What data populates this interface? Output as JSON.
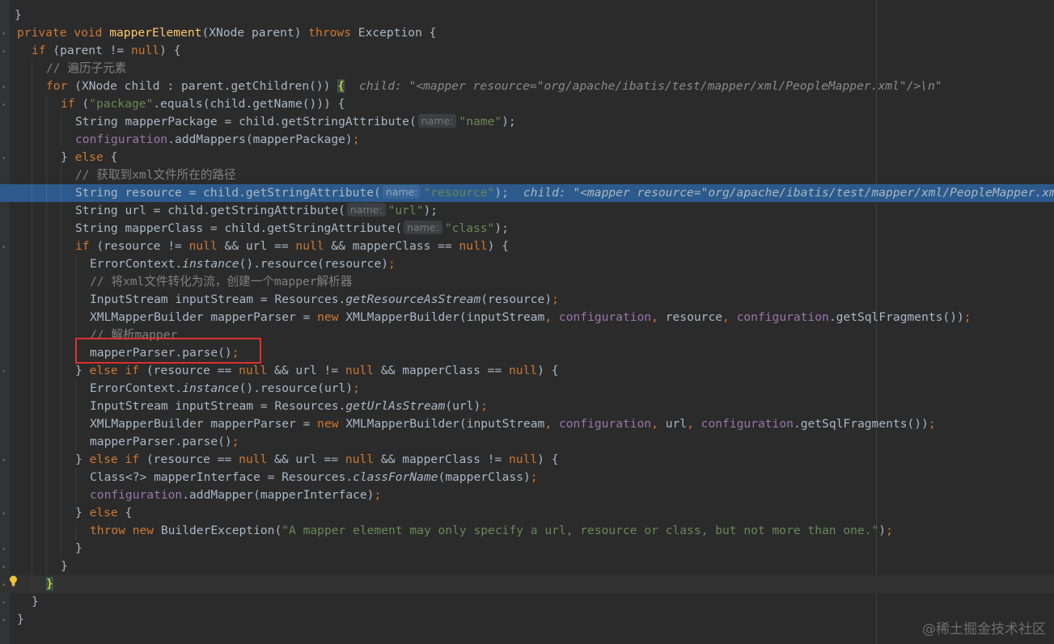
{
  "editor": {
    "lines": [
      {
        "id": "top",
        "tokens": [
          {
            "t": "}",
            "c": ""
          }
        ]
      },
      {
        "id": "method-decl",
        "tokens": [
          {
            "t": "private void ",
            "c": "kw"
          },
          {
            "t": "mapperElement",
            "c": "fn"
          },
          {
            "t": "(XNode parent) ",
            "c": ""
          },
          {
            "t": "throws ",
            "c": "kw"
          },
          {
            "t": "Exception {",
            "c": ""
          }
        ]
      },
      {
        "id": "if-parent",
        "tokens": [
          {
            "t": "if ",
            "c": "kw"
          },
          {
            "t": "(parent != ",
            "c": ""
          },
          {
            "t": "null",
            "c": "kw"
          },
          {
            "t": ") {",
            "c": ""
          }
        ]
      },
      {
        "id": "comment-iterate",
        "tokens": [
          {
            "t": "// 遍历子元素",
            "c": "cm"
          }
        ]
      },
      {
        "id": "for-loop",
        "tokens": [
          {
            "t": "for ",
            "c": "kw"
          },
          {
            "t": "(XNode child : parent.getChildren()) ",
            "c": ""
          },
          {
            "t": "{",
            "c": "brace-match"
          },
          {
            "t": "child: \"<mapper resource=\"org/apache/ibatis/test/mapper/xml/PeopleMapper.xml\"/>\\n\"",
            "c": "inline-val"
          }
        ]
      },
      {
        "id": "if-package",
        "tokens": [
          {
            "t": "if ",
            "c": "kw"
          },
          {
            "t": "(",
            "c": ""
          },
          {
            "t": "\"package\"",
            "c": "str"
          },
          {
            "t": ".equals(child.getName())) {",
            "c": ""
          }
        ]
      },
      {
        "id": "mapper-package",
        "tokens": [
          {
            "t": "String mapperPackage = child.getStringAttribute(",
            "c": ""
          },
          {
            "t": "name:",
            "c": "hint"
          },
          {
            "t": "\"name\"",
            "c": "str"
          },
          {
            "t": ");",
            "c": ""
          }
        ]
      },
      {
        "id": "add-mappers",
        "tokens": [
          {
            "t": "configuration",
            "c": "fld"
          },
          {
            "t": ".addMappers(mapperPackage)",
            "c": ""
          },
          {
            "t": ";",
            "c": "kw"
          }
        ]
      },
      {
        "id": "else-1",
        "tokens": [
          {
            "t": "} ",
            "c": ""
          },
          {
            "t": "else ",
            "c": "kw"
          },
          {
            "t": "{",
            "c": ""
          }
        ]
      },
      {
        "id": "comment-path",
        "tokens": [
          {
            "t": "// 获取到xml文件所在的路径",
            "c": "cm"
          }
        ]
      },
      {
        "id": "resource-line",
        "tokens": [
          {
            "t": "String resource = child.getStringAttribute(",
            "c": ""
          },
          {
            "t": "name:",
            "c": "hint"
          },
          {
            "t": "\"resource\"",
            "c": "str"
          },
          {
            "t": ");",
            "c": ""
          },
          {
            "t": "child: \"<mapper resource=\"org/apache/ibatis/test/mapper/xml/PeopleMapper.xml\"/>\\n\"",
            "c": "inline-val"
          }
        ]
      },
      {
        "id": "url-line",
        "tokens": [
          {
            "t": "String url = child.getStringAttribute(",
            "c": ""
          },
          {
            "t": "name:",
            "c": "hint"
          },
          {
            "t": "\"url\"",
            "c": "str"
          },
          {
            "t": ");",
            "c": ""
          }
        ]
      },
      {
        "id": "class-line",
        "tokens": [
          {
            "t": "String mapperClass = child.getStringAttribute(",
            "c": ""
          },
          {
            "t": "name:",
            "c": "hint"
          },
          {
            "t": "\"class\"",
            "c": "str"
          },
          {
            "t": ");",
            "c": ""
          }
        ]
      },
      {
        "id": "if-resource",
        "tokens": [
          {
            "t": "if ",
            "c": "kw"
          },
          {
            "t": "(resource != ",
            "c": ""
          },
          {
            "t": "null ",
            "c": "kw"
          },
          {
            "t": "&& url == ",
            "c": ""
          },
          {
            "t": "null ",
            "c": "kw"
          },
          {
            "t": "&& mapperClass == ",
            "c": ""
          },
          {
            "t": "null",
            "c": "kw"
          },
          {
            "t": ") {",
            "c": ""
          }
        ]
      },
      {
        "id": "error-context-1",
        "tokens": [
          {
            "t": "ErrorContext.",
            "c": ""
          },
          {
            "t": "instance",
            "c": "it"
          },
          {
            "t": "().resource(resource)",
            "c": ""
          },
          {
            "t": ";",
            "c": "kw"
          }
        ]
      },
      {
        "id": "comment-stream",
        "tokens": [
          {
            "t": "// 将xml文件转化为流，创建一个mapper解析器",
            "c": "cm"
          }
        ]
      },
      {
        "id": "input-stream-1",
        "tokens": [
          {
            "t": "InputStream inputStream = Resources.",
            "c": ""
          },
          {
            "t": "getResourceAsStream",
            "c": "it"
          },
          {
            "t": "(resource)",
            "c": ""
          },
          {
            "t": ";",
            "c": "kw"
          }
        ]
      },
      {
        "id": "builder-1",
        "tokens": [
          {
            "t": "XMLMapperBuilder mapperParser = ",
            "c": ""
          },
          {
            "t": "new ",
            "c": "kw"
          },
          {
            "t": "XMLMapperBuilder(inputStream",
            "c": ""
          },
          {
            "t": ", ",
            "c": "kw"
          },
          {
            "t": "configuration",
            "c": "fld"
          },
          {
            "t": ", ",
            "c": "kw"
          },
          {
            "t": "resource",
            "c": ""
          },
          {
            "t": ", ",
            "c": "kw"
          },
          {
            "t": "configuration",
            "c": "fld"
          },
          {
            "t": ".getSqlFragments())",
            "c": ""
          },
          {
            "t": ";",
            "c": "kw"
          }
        ]
      },
      {
        "id": "comment-parse",
        "tokens": [
          {
            "t": "// 解析mapper",
            "c": "cm"
          }
        ]
      },
      {
        "id": "parse-1",
        "tokens": [
          {
            "t": "mapperParser.parse()",
            "c": ""
          },
          {
            "t": ";",
            "c": "kw"
          }
        ]
      },
      {
        "id": "else-if-url",
        "tokens": [
          {
            "t": "} ",
            "c": ""
          },
          {
            "t": "else if ",
            "c": "kw"
          },
          {
            "t": "(resource == ",
            "c": ""
          },
          {
            "t": "null ",
            "c": "kw"
          },
          {
            "t": "&& url != ",
            "c": ""
          },
          {
            "t": "null ",
            "c": "kw"
          },
          {
            "t": "&& mapperClass == ",
            "c": ""
          },
          {
            "t": "null",
            "c": "kw"
          },
          {
            "t": ") {",
            "c": ""
          }
        ]
      },
      {
        "id": "error-context-2",
        "tokens": [
          {
            "t": "ErrorContext.",
            "c": ""
          },
          {
            "t": "instance",
            "c": "it"
          },
          {
            "t": "().resource(url)",
            "c": ""
          },
          {
            "t": ";",
            "c": "kw"
          }
        ]
      },
      {
        "id": "input-stream-2",
        "tokens": [
          {
            "t": "InputStream inputStream = Resources.",
            "c": ""
          },
          {
            "t": "getUrlAsStream",
            "c": "it"
          },
          {
            "t": "(url)",
            "c": ""
          },
          {
            "t": ";",
            "c": "kw"
          }
        ]
      },
      {
        "id": "builder-2",
        "tokens": [
          {
            "t": "XMLMapperBuilder mapperParser = ",
            "c": ""
          },
          {
            "t": "new ",
            "c": "kw"
          },
          {
            "t": "XMLMapperBuilder(inputStream",
            "c": ""
          },
          {
            "t": ", ",
            "c": "kw"
          },
          {
            "t": "configuration",
            "c": "fld"
          },
          {
            "t": ", ",
            "c": "kw"
          },
          {
            "t": "url",
            "c": ""
          },
          {
            "t": ", ",
            "c": "kw"
          },
          {
            "t": "configuration",
            "c": "fld"
          },
          {
            "t": ".getSqlFragments())",
            "c": ""
          },
          {
            "t": ";",
            "c": "kw"
          }
        ]
      },
      {
        "id": "parse-2",
        "tokens": [
          {
            "t": "mapperParser.parse()",
            "c": ""
          },
          {
            "t": ";",
            "c": "kw"
          }
        ]
      },
      {
        "id": "else-if-class",
        "tokens": [
          {
            "t": "} ",
            "c": ""
          },
          {
            "t": "else if ",
            "c": "kw"
          },
          {
            "t": "(resource == ",
            "c": ""
          },
          {
            "t": "null ",
            "c": "kw"
          },
          {
            "t": "&& url == ",
            "c": ""
          },
          {
            "t": "null ",
            "c": "kw"
          },
          {
            "t": "&& mapperClass != ",
            "c": ""
          },
          {
            "t": "null",
            "c": "kw"
          },
          {
            "t": ") {",
            "c": ""
          }
        ]
      },
      {
        "id": "class-for-name",
        "tokens": [
          {
            "t": "Class<?> mapperInterface = Resources.",
            "c": ""
          },
          {
            "t": "classForName",
            "c": "it"
          },
          {
            "t": "(mapperClass)",
            "c": ""
          },
          {
            "t": ";",
            "c": "kw"
          }
        ]
      },
      {
        "id": "add-mapper",
        "tokens": [
          {
            "t": "configuration",
            "c": "fld"
          },
          {
            "t": ".addMapper(mapperInterface)",
            "c": ""
          },
          {
            "t": ";",
            "c": "kw"
          }
        ]
      },
      {
        "id": "else-2",
        "tokens": [
          {
            "t": "} ",
            "c": ""
          },
          {
            "t": "else ",
            "c": "kw"
          },
          {
            "t": "{",
            "c": ""
          }
        ]
      },
      {
        "id": "throw-line",
        "tokens": [
          {
            "t": "throw new ",
            "c": "kw"
          },
          {
            "t": "BuilderException(",
            "c": ""
          },
          {
            "t": "\"A mapper element may only specify a url, resource or class, but not more than one.\"",
            "c": "str"
          },
          {
            "t": ")",
            "c": ""
          },
          {
            "t": ";",
            "c": "kw"
          }
        ]
      },
      {
        "id": "close-1",
        "tokens": [
          {
            "t": "}",
            "c": ""
          }
        ]
      },
      {
        "id": "close-2",
        "tokens": [
          {
            "t": "}",
            "c": ""
          }
        ]
      },
      {
        "id": "close-for",
        "tokens": [
          {
            "t": "}",
            "c": "brace-match"
          }
        ]
      },
      {
        "id": "close-if",
        "tokens": [
          {
            "t": "}",
            "c": ""
          }
        ]
      },
      {
        "id": "close-method",
        "tokens": [
          {
            "t": "}",
            "c": ""
          }
        ]
      }
    ],
    "highlighted_line": "resource-line",
    "caret_line": "close-for"
  },
  "watermark": "@稀土掘金技术社区",
  "colors": {
    "background": "#2b2b2b",
    "selection": "#2d5a8c",
    "keyword": "#cc7832",
    "method": "#ffc66d",
    "string": "#6a8759",
    "comment": "#808080",
    "field": "#9876aa",
    "annotation_box": "#e02e2e"
  }
}
